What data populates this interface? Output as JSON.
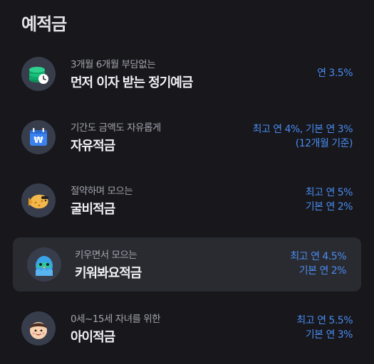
{
  "section": {
    "title": "예적금"
  },
  "products": [
    {
      "subtitle": "3개월 6개월 부담없는",
      "title": "먼저 이자 받는 정기예금",
      "rate_line1": "연 3.5%",
      "rate_line2": "",
      "icon": "coin-clock-icon"
    },
    {
      "subtitle": "기간도 금액도 자유롭게",
      "title": "자유적금",
      "rate_line1": "최고 연 4%, 기본 연 3%",
      "rate_line2": "(12개월 기준)",
      "icon": "won-calendar-icon"
    },
    {
      "subtitle": "절약하며 모으는",
      "title": "굴비적금",
      "rate_line1": "최고 연 5%",
      "rate_line2": "기본 연 2%",
      "icon": "fish-icon"
    },
    {
      "subtitle": "키우면서 모으는",
      "title": "키워봐요적금",
      "rate_line1": "최고 연 4.5%",
      "rate_line2": "기본 연 2%",
      "icon": "bird-egg-icon"
    },
    {
      "subtitle": "0세~15세 자녀를 위한",
      "title": "아이적금",
      "rate_line1": "최고 연 5.5%",
      "rate_line2": "기본 연 3%",
      "icon": "child-face-icon"
    }
  ],
  "colors": {
    "background": "#17171c",
    "highlight_row": "#2a2b31",
    "rate_text": "#4a8cf0",
    "title_text": "#f1f1f4",
    "subtitle_text": "#a3a5ad"
  }
}
